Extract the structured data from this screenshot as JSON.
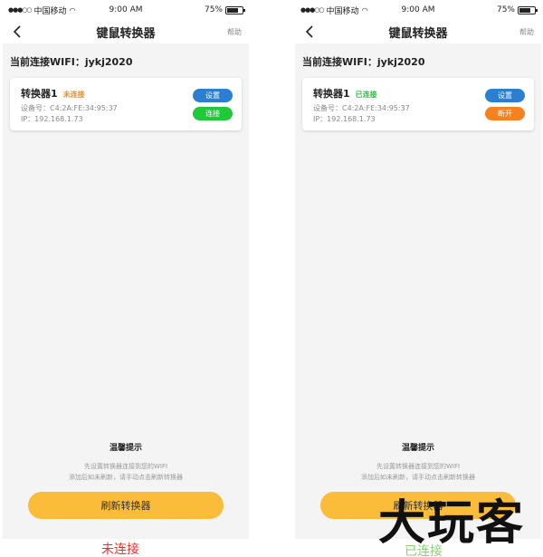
{
  "status_bar": {
    "carrier": "中国移动",
    "time": "9:00 AM",
    "battery": "75%",
    "battery_level": 0.75
  },
  "nav": {
    "title": "键鼠转换器",
    "help": "帮助"
  },
  "wifi": {
    "label": "当前连接WIFI：jykj2020"
  },
  "screens": [
    {
      "device": {
        "name": "转换器1",
        "status": "未连接",
        "mac": "设备号：C4:2A:FE:34:95:37",
        "ip": "IP：192.168.1.73"
      },
      "buttons": {
        "settings": "设置",
        "action": "连接"
      }
    },
    {
      "device": {
        "name": "转换器1",
        "status": "已连接",
        "mac": "设备号：C4:2A:FE:34:95:37",
        "ip": "IP：192.168.1.73"
      },
      "buttons": {
        "settings": "设置",
        "action": "断开"
      }
    }
  ],
  "tips": {
    "title": "温馨提示",
    "line1": "先设置转换器连接到您的WIFI",
    "line2": "添加后如未刷新，请手动点击刷新转换器"
  },
  "refresh_button": "刷新转换器",
  "captions": {
    "left": "未连接",
    "right": "已连接"
  },
  "watermark": "大玩客",
  "colors": {
    "orange_status": "#f08a24",
    "green_status": "#2bbf3a",
    "blue_button": "#2a7fd1",
    "green_button": "#1ec93a",
    "orange_button": "#f5821f",
    "refresh_yellow": "#fbbc3a",
    "caption_red": "#e5322b"
  }
}
